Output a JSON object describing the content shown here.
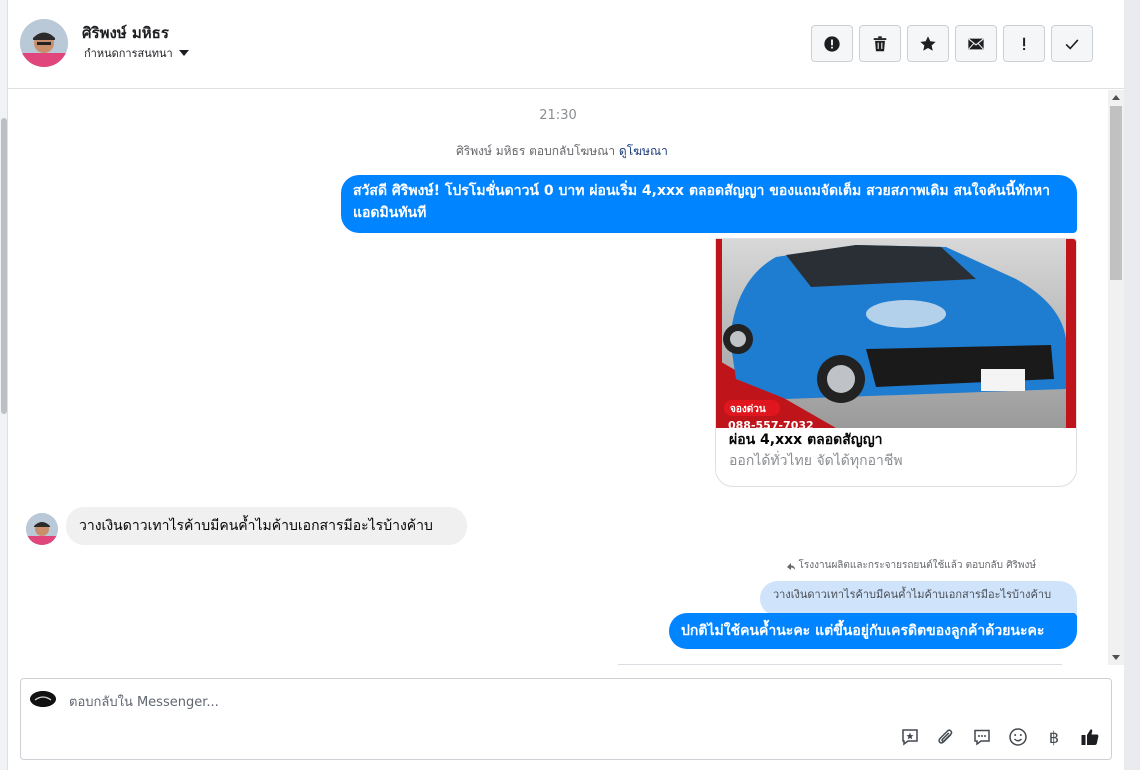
{
  "header": {
    "contact_name": "ศิริพงษ์ มหิธร",
    "conversation_setting": "กำหนดการสนทนา",
    "actions": [
      {
        "name": "report-spam-button",
        "icon": "alert-circle-icon"
      },
      {
        "name": "delete-button",
        "icon": "trash-icon"
      },
      {
        "name": "star-button",
        "icon": "star-icon"
      },
      {
        "name": "mark-unread-button",
        "icon": "envelope-icon"
      },
      {
        "name": "mark-important-button",
        "icon": "exclamation-icon"
      },
      {
        "name": "mark-done-button",
        "icon": "check-icon"
      }
    ]
  },
  "thread": {
    "timestamp": "21:30",
    "ad_reply_text": "ศิริพงษ์ มหิธร ตอบกลับโฆษณา ",
    "ad_reply_link": "ดูโฆษณา",
    "outgoing_message_1": "สวัสดี ศิริพงษ์! โปรโมชั่นดาวน์ 0 บาท ผ่อนเริ่ม 4,xxx ตลอดสัญญา ของแถมจัดเต็ม สวยสภาพเดิม สนใจคันนี้ทักหาแอดมินทันที",
    "ad_card": {
      "image_badge": "จองด่วน",
      "image_phone": "088-557-7032",
      "title": "ผ่อน 4,xxx ตลอดสัญญา",
      "subtitle": "ออกได้ทั่วไทย จัดได้ทุกอาชีพ"
    },
    "incoming_message_1": "วางเงินดาวเทาไรค้าบมีคนค้ำไมค้าบเอกสารมีอะไรบ้างค้าบ",
    "reply_note": "โรงงานผลิตและกระจายรถยนต์ใช้แล้ว ตอบกลับ ศิริพงษ์",
    "quoted_message": "วางเงินดาวเทาไรค้าบมีคนค้ำไมค้าบเอกสารมีอะไรบ้างค้าบ",
    "outgoing_message_2": "ปกติไม่ใช้คนค้ำนะคะ แต่ขึ้นอยู่กับเครดิตของลูกค้าด้วยนะคะ"
  },
  "composer": {
    "placeholder": "ตอบกลับใน Messenger...",
    "tools": [
      "saved-reply-icon",
      "paperclip-icon",
      "chat-bubble-icon",
      "emoji-icon",
      "baht-icon",
      "thumbs-up-icon"
    ],
    "baht_symbol": "฿"
  },
  "colors": {
    "accent": "#0084ff",
    "incoming_bubble": "#f0f0f0",
    "quoted_bubble": "#cfe3fb"
  }
}
